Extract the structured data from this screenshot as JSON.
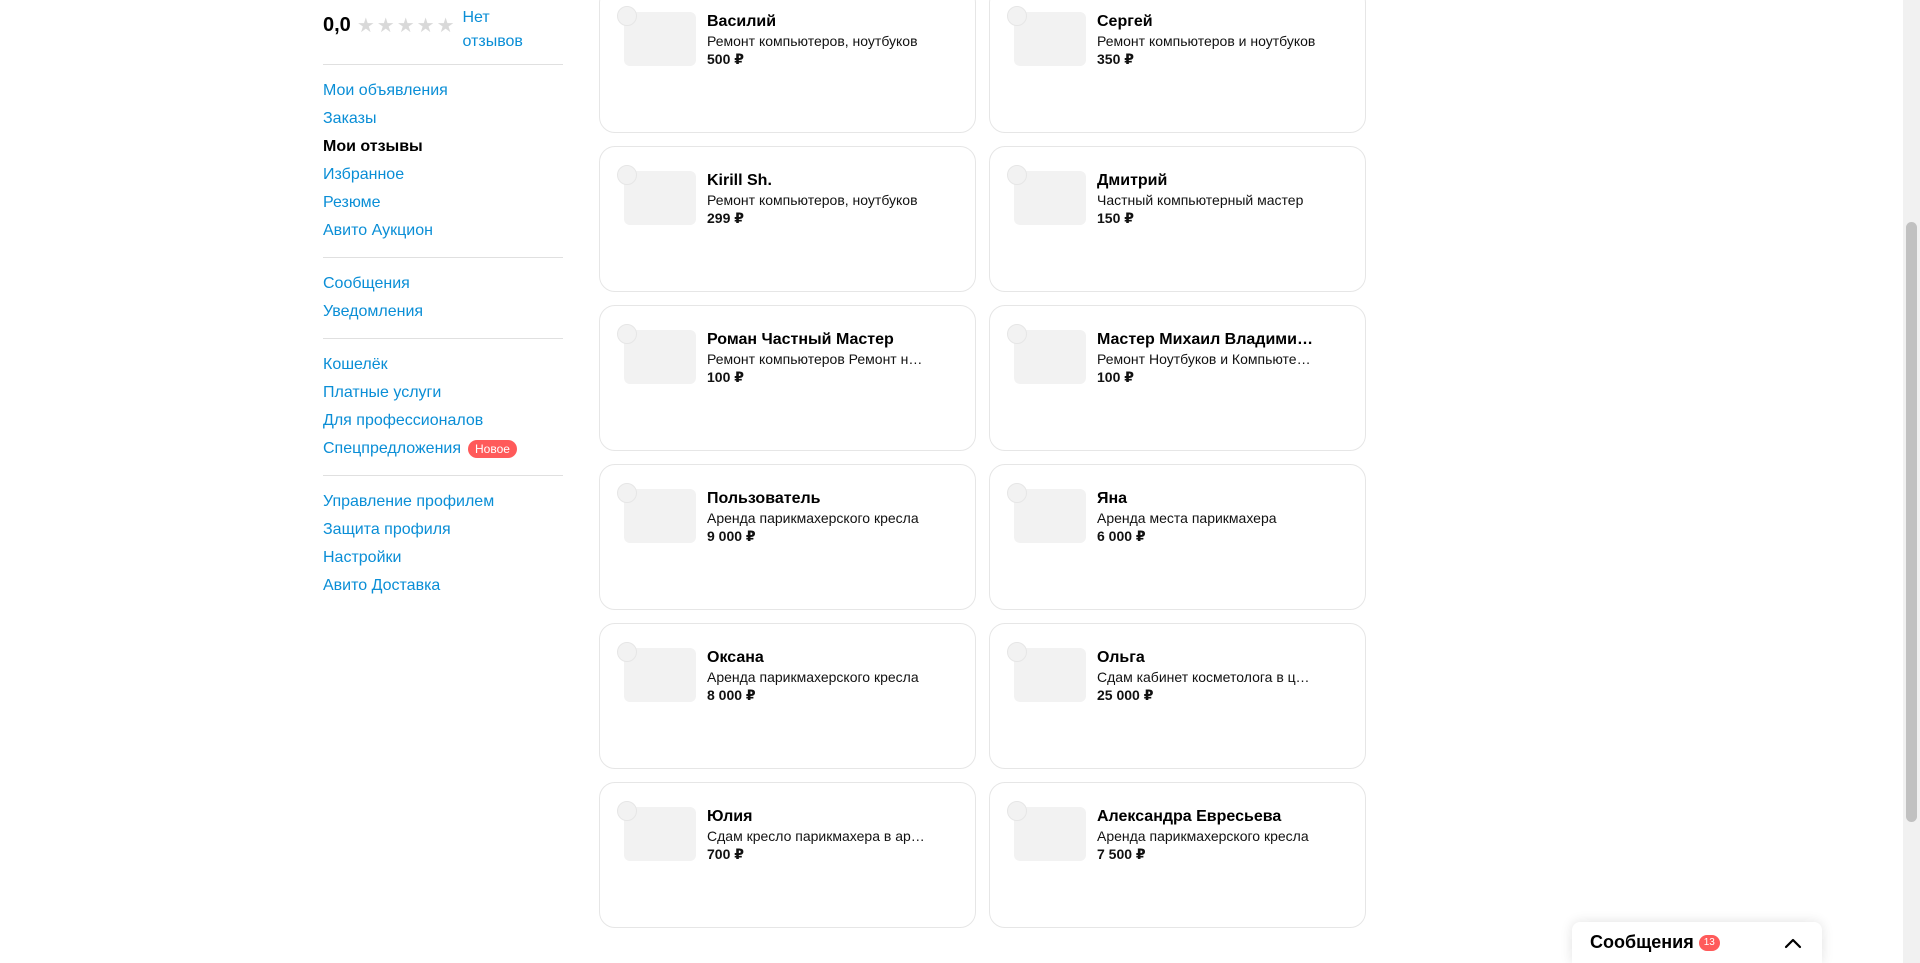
{
  "sidebar": {
    "rating": "0,0",
    "stars": [
      "★",
      "★",
      "★",
      "★",
      "★"
    ],
    "no_reviews": "Нет отзывов",
    "groups": [
      [
        {
          "label": "Мои объявления",
          "active": false
        },
        {
          "label": "Заказы",
          "active": false
        },
        {
          "label": "Мои отзывы",
          "active": true
        },
        {
          "label": "Избранное",
          "active": false
        },
        {
          "label": "Резюме",
          "active": false
        },
        {
          "label": "Авито Аукцион",
          "active": false
        }
      ],
      [
        {
          "label": "Сообщения",
          "active": false
        },
        {
          "label": "Уведомления",
          "active": false
        }
      ],
      [
        {
          "label": "Кошелёк",
          "active": false
        },
        {
          "label": "Платные услуги",
          "active": false
        },
        {
          "label": "Для профессионалов",
          "active": false
        },
        {
          "label": "Спецпредложения",
          "active": false,
          "badge": "Новое"
        }
      ],
      [
        {
          "label": "Управление профилем",
          "active": false
        },
        {
          "label": "Защита профиля",
          "active": false
        },
        {
          "label": "Настройки",
          "active": false
        },
        {
          "label": "Авито Доставка",
          "active": false
        }
      ]
    ]
  },
  "cards": [
    {
      "name": "Василий",
      "desc": "Ремонт компьютеров, ноутбуков",
      "price": "500 ₽"
    },
    {
      "name": "Сергей",
      "desc": "Ремонт компьютеров и ноутбуков",
      "price": "350 ₽"
    },
    {
      "name": "Kirill Sh.",
      "desc": "Ремонт компьютеров, ноутбуков",
      "price": "299 ₽"
    },
    {
      "name": "Дмитрий",
      "desc": "Частный компьютерный мастер",
      "price": "150 ₽"
    },
    {
      "name": "Роман Частный Мастер",
      "desc": "Ремонт компьютеров Ремонт ноутбуков",
      "price": "100 ₽"
    },
    {
      "name": "Мастер Михаил Владимирович",
      "desc": "Ремонт Ноутбуков и Компьютеров",
      "price": "100 ₽"
    },
    {
      "name": "Пользователь",
      "desc": "Аренда парикмахерского кресла",
      "price": "9 000 ₽"
    },
    {
      "name": "Яна",
      "desc": "Аренда места парикмахера",
      "price": "6 000 ₽"
    },
    {
      "name": "Оксана",
      "desc": "Аренда парикмахерского кресла",
      "price": "8 000 ₽"
    },
    {
      "name": "Ольга",
      "desc": "Сдам кабинет косметолога в центре",
      "price": "25 000 ₽"
    },
    {
      "name": "Юлия",
      "desc": "Сдам кресло парикмахера в аренду",
      "price": "700 ₽"
    },
    {
      "name": "Александра Евресьева",
      "desc": "Аренда парикмахерского кресла",
      "price": "7 500 ₽"
    }
  ],
  "messages_widget": {
    "title": "Сообщения",
    "count": "13",
    "chevron_icon": "chevron-up-icon"
  },
  "colors": {
    "link": "#0a8ed6",
    "badge": "#ff5a5a",
    "star_empty": "#d9d9d9"
  }
}
